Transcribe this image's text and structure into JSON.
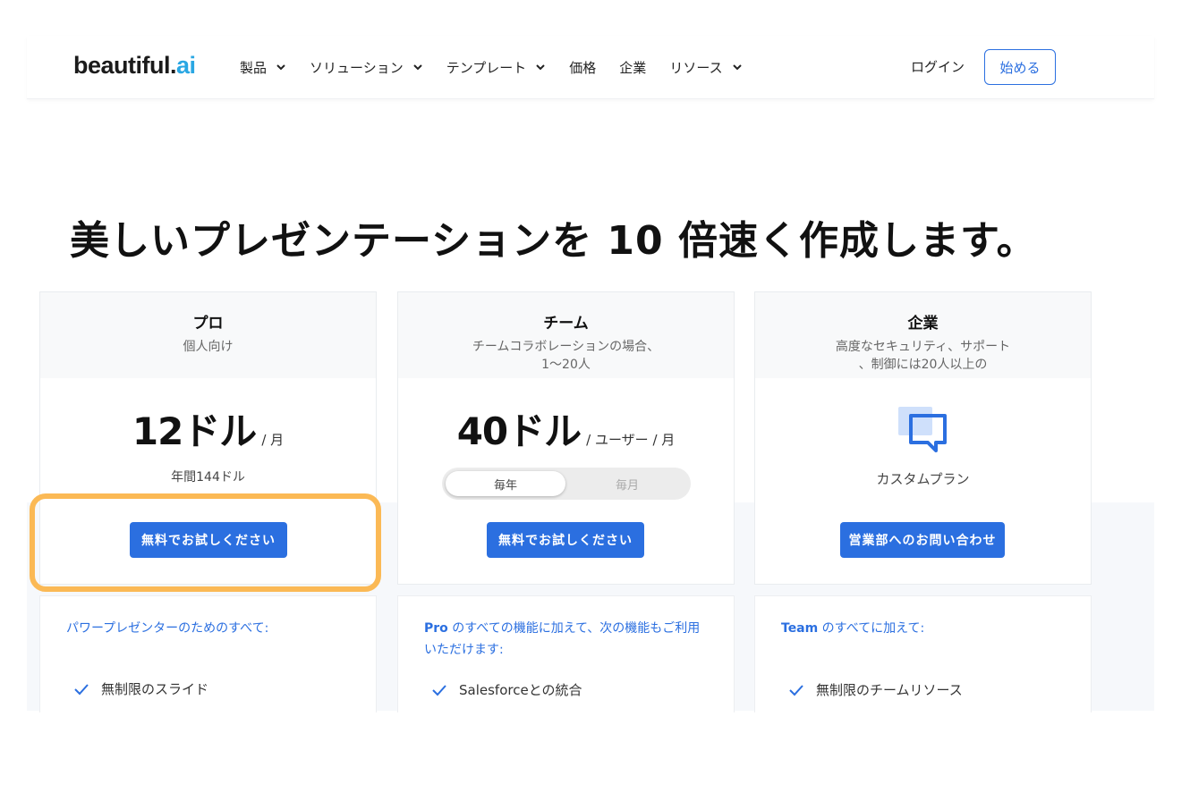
{
  "nav": {
    "logo_main": "beautiful.",
    "logo_ai": "ai",
    "items": [
      {
        "label": "製品",
        "dropdown": true
      },
      {
        "label": "ソリューション",
        "dropdown": true
      },
      {
        "label": "テンプレート",
        "dropdown": true
      },
      {
        "label": "価格",
        "dropdown": false
      },
      {
        "label": "企業",
        "dropdown": false
      },
      {
        "label": "リソース",
        "dropdown": true
      }
    ],
    "login": "ログイン",
    "start": "始める"
  },
  "hero": {
    "title": "美しいプレゼンテーションを 10 倍速く作成します。"
  },
  "plans": [
    {
      "name": "プロ",
      "subtitle": "個人向け",
      "price": "12ドル",
      "per": "/ 月",
      "annual": "年間144ドル",
      "cta": "無料でお試しください"
    },
    {
      "name": "チーム",
      "subtitle_line1": "チームコラボレーションの場合、",
      "subtitle_line2": "1〜20人",
      "price": "40ドル",
      "per": "/ ユーザー / 月",
      "toggle_on": "毎年",
      "toggle_off": "毎月",
      "cta": "無料でお試しください"
    },
    {
      "name": "企業",
      "subtitle_line1": "高度なセキュリティ、サポート",
      "subtitle_line2": "、制御には20人以上の",
      "custom": "カスタムプラン",
      "cta": "営業部へのお問い合わせ"
    }
  ],
  "features": [
    {
      "intro": "パワープレゼンターのためのすべて:",
      "items": [
        "無制限のスライド"
      ]
    },
    {
      "intro_bold": "Pro",
      "intro": " のすべての機能に加えて、次の機能もご利用いただけます:",
      "items": [
        "Salesforceとの統合"
      ]
    },
    {
      "intro_bold": "Team",
      "intro": " のすべてに加えて:",
      "items": [
        "無制限のチームリソース"
      ]
    }
  ],
  "colors": {
    "accent": "#2b6fe0",
    "highlight": "#fbb955",
    "logo_dot": "#2aa7e3"
  }
}
